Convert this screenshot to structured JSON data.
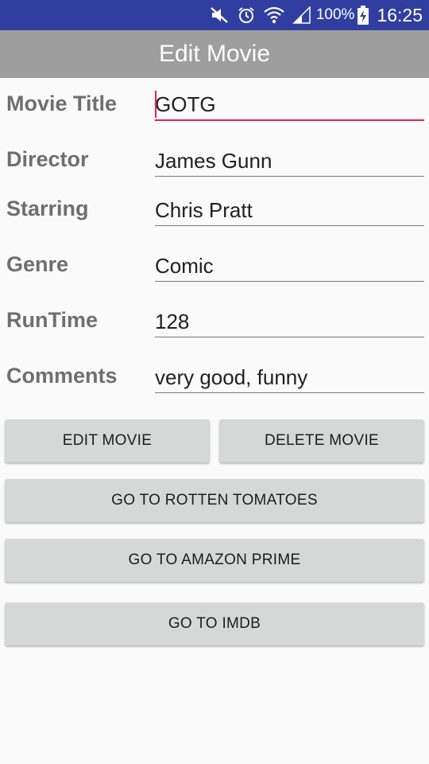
{
  "status_bar": {
    "battery_percent": "100%",
    "time": "16:25",
    "icons": [
      "mute-icon",
      "alarm-icon",
      "wifi-icon",
      "signal-icon",
      "battery-charging-icon"
    ],
    "background": "#303f9f"
  },
  "action_bar": {
    "title": "Edit Movie",
    "background": "#9e9e9e"
  },
  "form": {
    "fields": [
      {
        "label": "Movie Title",
        "value": "GOTG"
      },
      {
        "label": "Director",
        "value": "James Gunn"
      },
      {
        "label": "Starring",
        "value": "Chris Pratt"
      },
      {
        "label": "Genre",
        "value": "Comic"
      },
      {
        "label": "RunTime",
        "value": "128"
      },
      {
        "label": "Comments",
        "value": "very good, funny"
      }
    ],
    "focused_index": 0,
    "accent": "#e91e63"
  },
  "buttons": {
    "edit": "EDIT MOVIE",
    "delete": "DELETE MOVIE",
    "rotten": "GO TO ROTTEN TOMATOES",
    "amazon": "GO TO AMAZON PRIME",
    "imdb": "GO TO IMDB"
  }
}
